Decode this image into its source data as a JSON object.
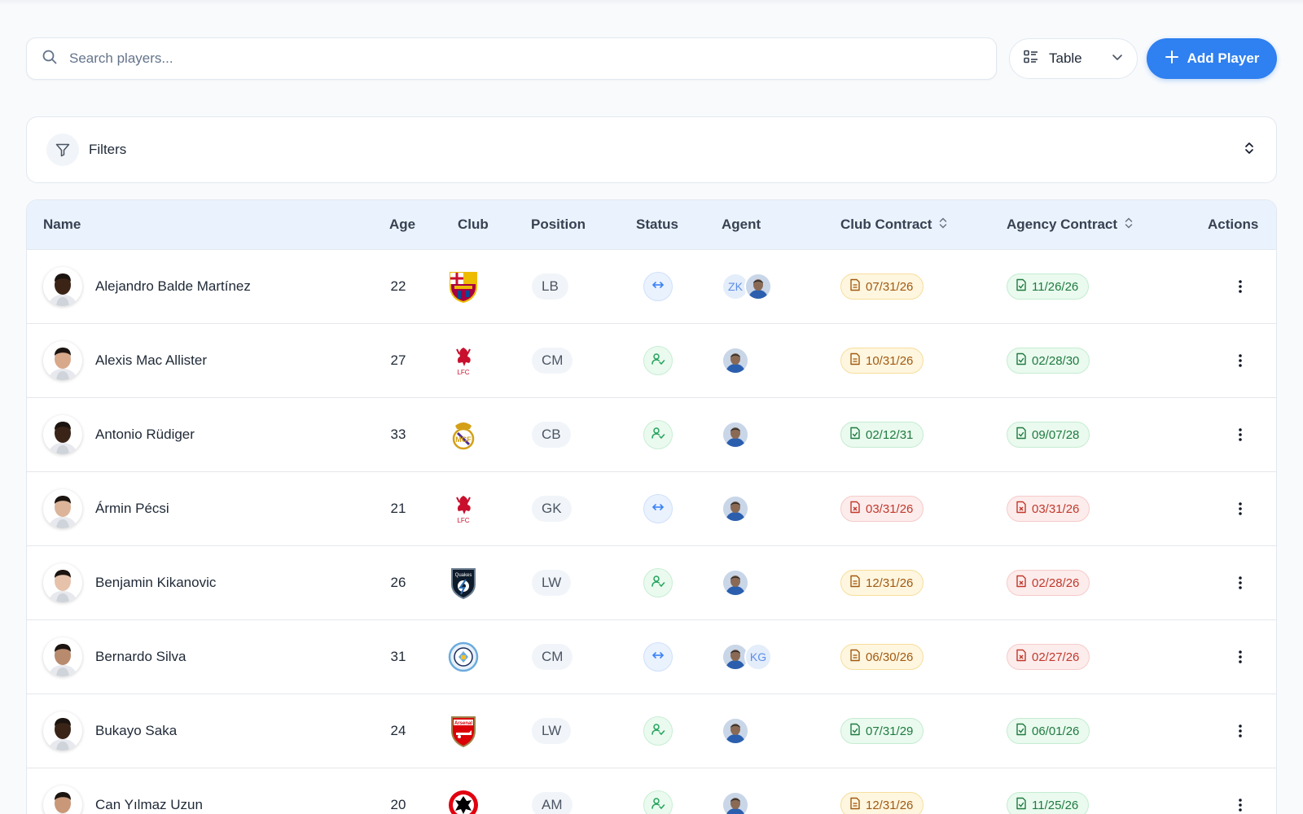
{
  "search": {
    "placeholder": "Search players..."
  },
  "view_select": {
    "label": "Table",
    "icon": "list-view-icon"
  },
  "add_button": {
    "label": "Add Player"
  },
  "filters": {
    "label": "Filters"
  },
  "table": {
    "headers": {
      "name": "Name",
      "age": "Age",
      "club": "Club",
      "position": "Position",
      "status": "Status",
      "agent": "Agent",
      "club_contract": "Club Contract",
      "agency_contract": "Agency Contract",
      "actions": "Actions"
    },
    "rows": [
      {
        "name": "Alejandro Balde Martínez",
        "age": "22",
        "club": "FC Barcelona crest",
        "position": "LB",
        "status": "transfer",
        "agents": [
          "ZK",
          "photo"
        ],
        "club_contract": "07/31/26",
        "club_contract_state": "warn",
        "agency_contract": "11/26/26",
        "agency_contract_state": "ok",
        "skin": "#3b2416"
      },
      {
        "name": "Alexis Mac Allister",
        "age": "27",
        "club": "Liverpool crest",
        "position": "CM",
        "status": "active",
        "agents": [
          "photo"
        ],
        "club_contract": "10/31/26",
        "club_contract_state": "warn",
        "agency_contract": "02/28/30",
        "agency_contract_state": "ok",
        "skin": "#d8a88a"
      },
      {
        "name": "Antonio Rüdiger",
        "age": "33",
        "club": "Real Madrid crest",
        "position": "CB",
        "status": "active",
        "agents": [
          "photo"
        ],
        "club_contract": "02/12/31",
        "club_contract_state": "ok",
        "agency_contract": "09/07/28",
        "agency_contract_state": "ok",
        "skin": "#3a2418"
      },
      {
        "name": "Ármin Pécsi",
        "age": "21",
        "club": "Liverpool crest",
        "position": "GK",
        "status": "transfer",
        "agents": [
          "photo"
        ],
        "club_contract": "03/31/26",
        "club_contract_state": "bad",
        "agency_contract": "03/31/26",
        "agency_contract_state": "bad",
        "skin": "#dcb49a"
      },
      {
        "name": "Benjamin Kikanovic",
        "age": "26",
        "club": "San Jose Earthquakes crest",
        "position": "LW",
        "status": "active",
        "agents": [
          "photo"
        ],
        "club_contract": "12/31/26",
        "club_contract_state": "warn",
        "agency_contract": "02/28/26",
        "agency_contract_state": "bad",
        "skin": "#e6c2ab"
      },
      {
        "name": "Bernardo Silva",
        "age": "31",
        "club": "Manchester City crest",
        "position": "CM",
        "status": "transfer",
        "agents": [
          "photo",
          "KG"
        ],
        "club_contract": "06/30/26",
        "club_contract_state": "warn",
        "agency_contract": "02/27/26",
        "agency_contract_state": "bad",
        "skin": "#b88a6e"
      },
      {
        "name": "Bukayo Saka",
        "age": "24",
        "club": "Arsenal crest",
        "position": "LW",
        "status": "active",
        "agents": [
          "photo"
        ],
        "club_contract": "07/31/29",
        "club_contract_state": "ok",
        "agency_contract": "06/01/26",
        "agency_contract_state": "ok",
        "skin": "#3a2418"
      },
      {
        "name": "Can Yılmaz Uzun",
        "age": "20",
        "club": "Eintracht Frankfurt crest",
        "position": "AM",
        "status": "active",
        "agents": [
          "photo"
        ],
        "club_contract": "12/31/26",
        "club_contract_state": "warn",
        "agency_contract": "11/25/26",
        "agency_contract_state": "ok",
        "skin": "#c99878"
      }
    ]
  },
  "colors": {
    "accent": "#2f80f0",
    "header_bg": "#eaf3fd",
    "warn": "#a05a12",
    "ok": "#1f7a3f",
    "bad": "#c0392b"
  }
}
